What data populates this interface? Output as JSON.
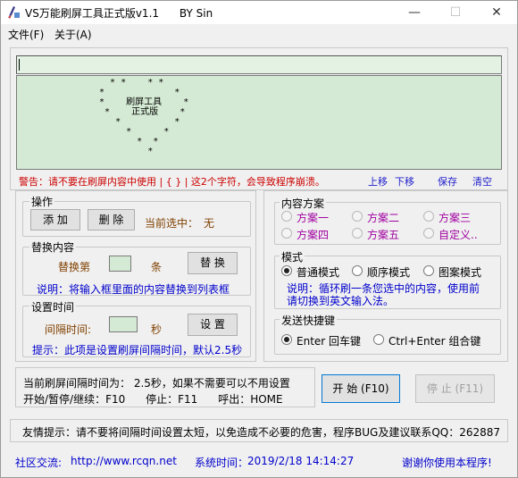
{
  "window": {
    "title": "VS万能刷屏工具正式版v1.1      BY Sin",
    "minimize": "—",
    "maximize": "☐",
    "close": "✕"
  },
  "menu": {
    "file": "文件(F)",
    "about": "关于(A)"
  },
  "editor": {
    "input_value": "",
    "preview_text": "   * *    * *\n *             *\n *    刷屏工具    *\n  *    正式版    *\n    *          *\n      *      *\n        *  *\n          *"
  },
  "warning_text": "警告：请不要在刷屏内容中使用 | { } | 这2个字符，会导致程序崩溃。",
  "list_actions": {
    "up": "上移",
    "down": "下移",
    "save": "保存",
    "clear": "清空"
  },
  "operation": {
    "legend": "操作",
    "add": "添 加",
    "delete": "删 除",
    "current_label": "当前选中：",
    "current_value": "无"
  },
  "replace": {
    "legend": "替换内容",
    "label_prefix": "替换第",
    "label_suffix": "条",
    "button": "替 换",
    "note": "说明：将输入框里面的内容替换到列表框"
  },
  "interval": {
    "legend": "设置时间",
    "label": "间隔时间:",
    "unit": "秒",
    "button": "设 置",
    "note": "提示：此项是设置刷屏间隔时间，默认2.5秒"
  },
  "content_plan": {
    "legend": "内容方案",
    "options": [
      "方案一",
      "方案二",
      "方案三",
      "方案四",
      "方案五",
      "自定义.."
    ]
  },
  "mode": {
    "legend": "模式",
    "options": [
      "普通模式",
      "顺序模式",
      "图案模式"
    ],
    "note": "说明：循环刷一条您选中的内容，使用前请切换到英文输入法。"
  },
  "send_key": {
    "legend": "发送快捷键",
    "options": [
      "Enter 回车键",
      "Ctrl+Enter 组合键"
    ]
  },
  "status": {
    "interval_text": "当前刷屏间隔时间为：  2.5秒，如果不需要可以不用设置",
    "hotkeys": "开始/暂停/继续：F10      停止：F11      呼出：HOME"
  },
  "controls": {
    "start": "开 始 (F10)",
    "stop": "停 止 (F11)"
  },
  "tip": "友情提示：请不要将间隔时间设置太短，以免造成不必要的危害，程序BUG及建议联系QQ：262887",
  "footer": {
    "community_label": "社区交流:",
    "community_url": "http://www.rcqn.net",
    "time_label": "系统时间：",
    "time_value": "2019/2/18 14:14:27",
    "thanks": "谢谢你使用本程序!"
  },
  "colors": {
    "warning": "#cc0000",
    "link": "#1f1fcc",
    "plan_option": "#a000a0",
    "current_value": "#804000",
    "note": "#0000cc",
    "textbox_bg": "#d4ead4"
  }
}
